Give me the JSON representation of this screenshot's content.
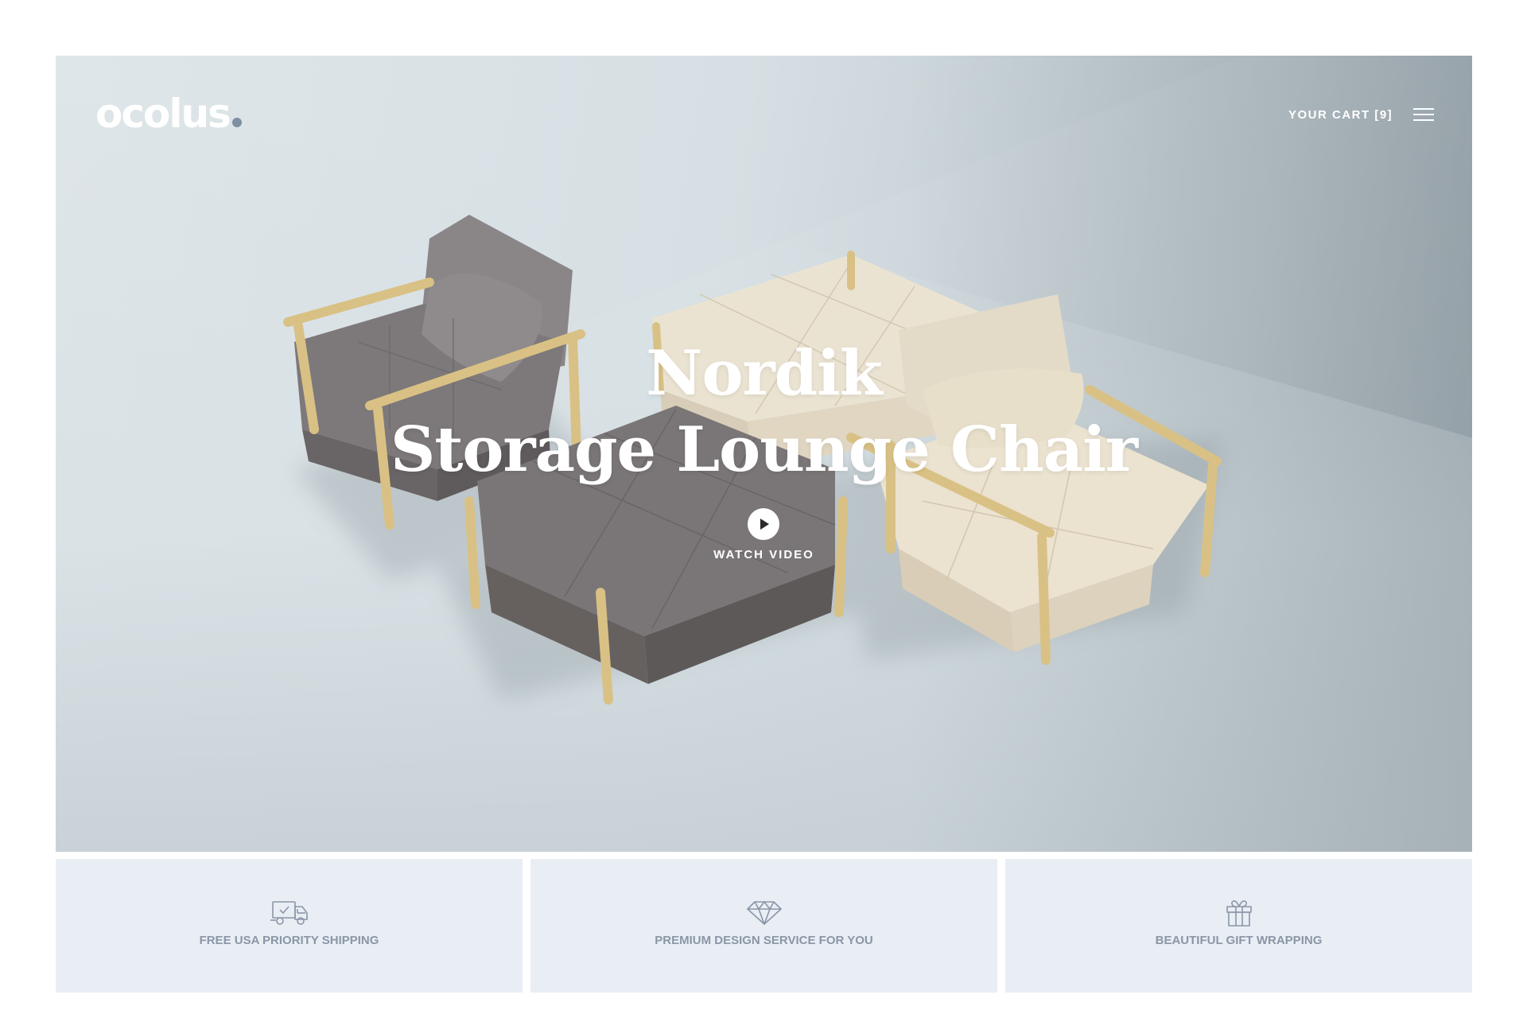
{
  "brand": {
    "name": "ocolus",
    "accent": "#7e8fa3"
  },
  "nav": {
    "cart_label": "YOUR CART [9]",
    "menu_icon": "hamburger-menu-icon"
  },
  "hero": {
    "title_line1": "Nordik",
    "title_line2": "Storage Lounge Chair",
    "cta_label": "WATCH VIDEO",
    "cta_icon": "play-icon"
  },
  "features": [
    {
      "icon": "delivery-truck-icon",
      "label": "FREE USA PRIORITY SHIPPING"
    },
    {
      "icon": "diamond-icon",
      "label": "PREMIUM DESIGN SERVICE FOR YOU"
    },
    {
      "icon": "gift-icon",
      "label": "BEAUTIFUL GIFT WRAPPING"
    }
  ],
  "colors": {
    "feature_bg": "#e9eef5",
    "feature_text": "#8a96a6",
    "grey_fabric": "#7a7677",
    "cream_fabric": "#e6ddcb",
    "wood": "#dcc48a"
  }
}
